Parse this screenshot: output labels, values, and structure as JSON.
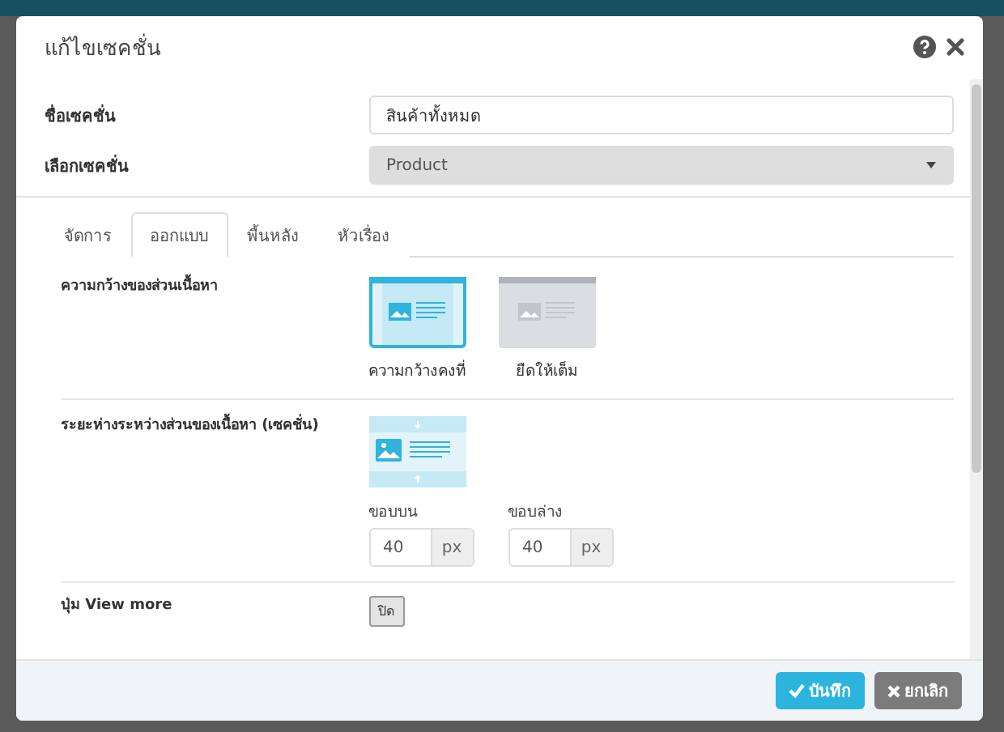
{
  "dialog": {
    "title": "แก้ไขเซคชั่น"
  },
  "fields": [
    {
      "label": "ชื่อเซคชั่น",
      "kind": "text",
      "value": "สินค้าทั้งหมด",
      "disabled": false
    },
    {
      "label": "เลือกเซคชั่น",
      "kind": "select",
      "value": "Product",
      "disabled": true
    }
  ],
  "tabs": [
    {
      "label": "จัดการ",
      "selected": false
    },
    {
      "label": "ออกแบบ",
      "selected": true
    },
    {
      "label": "พื้นหลัง",
      "selected": false
    },
    {
      "label": "หัวเรื่อง",
      "selected": false
    }
  ],
  "width_setting": {
    "label": "ความกว้างของส่วนเนื้อหา",
    "options": [
      {
        "label": "ความกว้างคงที่",
        "selected": true
      },
      {
        "label": "ยืดให้เต็ม",
        "selected": false
      }
    ]
  },
  "spacing_setting": {
    "label": "ระยะห่างระหว่างส่วนของเนื้อหา (เซคชั่น)",
    "inputs": [
      {
        "label": "ขอบบน",
        "value": "40",
        "unit": "px"
      },
      {
        "label": "ขอบล่าง",
        "value": "40",
        "unit": "px"
      }
    ]
  },
  "view_more": {
    "label": "ปุ่ม View more",
    "toggle": {
      "label": "ปิด",
      "on": false
    }
  },
  "buttons": [
    {
      "label": "บันทึก",
      "kind": "primary"
    },
    {
      "label": "ยกเลิก",
      "kind": "default"
    }
  ]
}
